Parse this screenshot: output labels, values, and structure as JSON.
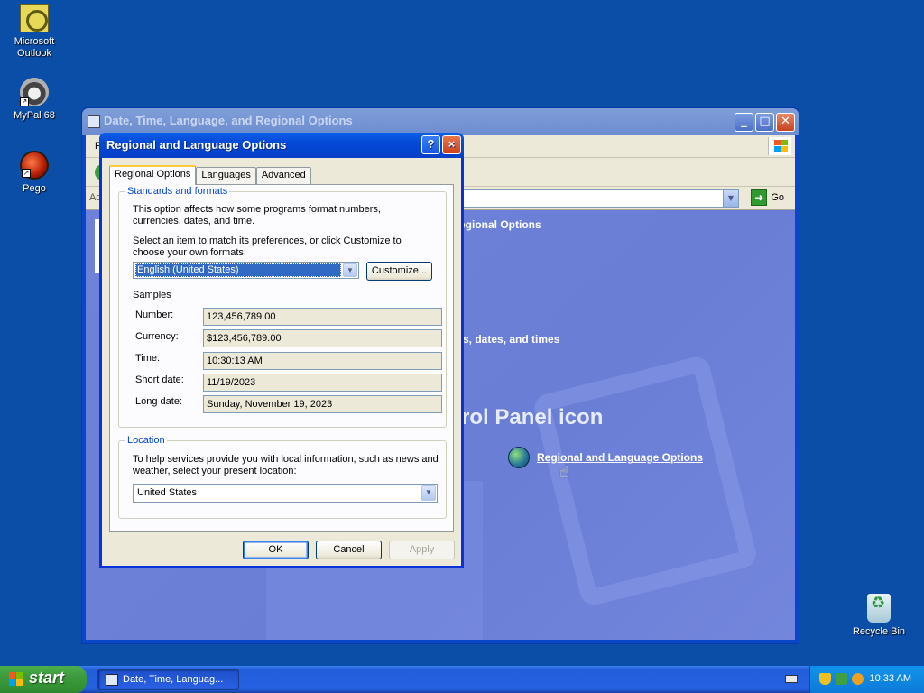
{
  "desktop": {
    "icons": [
      {
        "label": "Microsoft Outlook",
        "icon": "outlook-icon"
      },
      {
        "label": "MyPal 68",
        "icon": "mypal-icon"
      },
      {
        "label": "Pego",
        "icon": "pego-icon"
      },
      {
        "label": "Recycle Bin",
        "icon": "recycle-bin-icon"
      }
    ]
  },
  "explorer": {
    "title": "Date, Time, Language, and Regional Options",
    "menubar_visible_letter": "F",
    "address_label": "Ad",
    "go_label": "Go",
    "content": {
      "breadcrumb_partial": "egional Options",
      "category_partial": "s, dates, and times",
      "heading_partial": "rol Panel icon",
      "link_label": "Regional and Language Options"
    }
  },
  "dialog": {
    "title": "Regional and Language Options",
    "help_button": "?",
    "close_button": "×",
    "tabs": [
      "Regional Options",
      "Languages",
      "Advanced"
    ],
    "standards": {
      "legend": "Standards and formats",
      "desc1": "This option affects how some programs format numbers, currencies, dates, and time.",
      "desc2": "Select an item to match its preferences, or click Customize to choose your own formats:",
      "selected_format": "English (United States)",
      "customize_label": "Customize...",
      "samples_label": "Samples",
      "samples": [
        {
          "label": "Number:",
          "value": "123,456,789.00"
        },
        {
          "label": "Currency:",
          "value": "$123,456,789.00"
        },
        {
          "label": "Time:",
          "value": "10:30:13 AM"
        },
        {
          "label": "Short date:",
          "value": "11/19/2023"
        },
        {
          "label": "Long date:",
          "value": "Sunday, November 19, 2023"
        }
      ]
    },
    "location": {
      "legend": "Location",
      "desc": "To help services provide you with local information, such as news and weather, select your present location:",
      "selected_location": "United States"
    },
    "buttons": {
      "ok": "OK",
      "cancel": "Cancel",
      "apply": "Apply"
    }
  },
  "taskbar": {
    "start_label": "start",
    "task_item": "Date, Time, Languag...",
    "clock": "10:33 AM"
  },
  "colors": {
    "desktop": "#0a4ea8",
    "title_bar": "#0548d6",
    "dialog_face": "#ece9d8",
    "selection": "#316ac5",
    "legend_blue": "#0046d5",
    "start_green": "#3c9a3c"
  }
}
